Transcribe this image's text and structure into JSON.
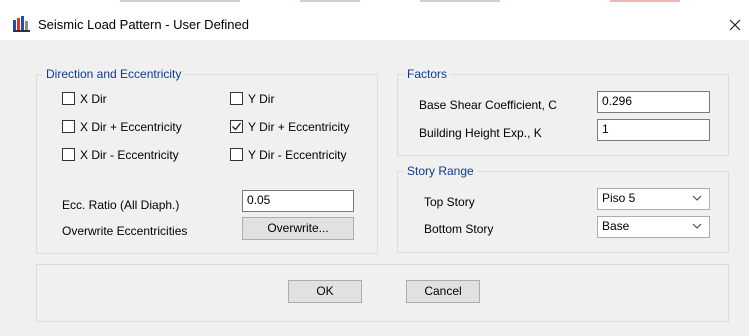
{
  "window": {
    "title": "Seismic Load Pattern - User Defined"
  },
  "direction": {
    "legend": "Direction and Eccentricity",
    "options": [
      {
        "label": "X Dir",
        "checked": false
      },
      {
        "label": "Y Dir",
        "checked": false
      },
      {
        "label": "X Dir + Eccentricity",
        "checked": false
      },
      {
        "label": "Y Dir + Eccentricity",
        "checked": true
      },
      {
        "label": "X Dir - Eccentricity",
        "checked": false
      },
      {
        "label": "Y Dir - Eccentricity",
        "checked": false
      }
    ],
    "ecc_ratio_label": "Ecc. Ratio (All Diaph.)",
    "ecc_ratio_value": "0.05",
    "overwrite_label": "Overwrite Eccentricities",
    "overwrite_button": "Overwrite..."
  },
  "factors": {
    "legend": "Factors",
    "base_shear_label": "Base Shear Coefficient, C",
    "base_shear_value": "0.296",
    "height_exp_label": "Building Height Exp., K",
    "height_exp_value": "1"
  },
  "story_range": {
    "legend": "Story Range",
    "top_label": "Top Story",
    "top_value": "Piso 5",
    "bottom_label": "Bottom Story",
    "bottom_value": "Base"
  },
  "buttons": {
    "ok": "OK",
    "cancel": "Cancel"
  }
}
